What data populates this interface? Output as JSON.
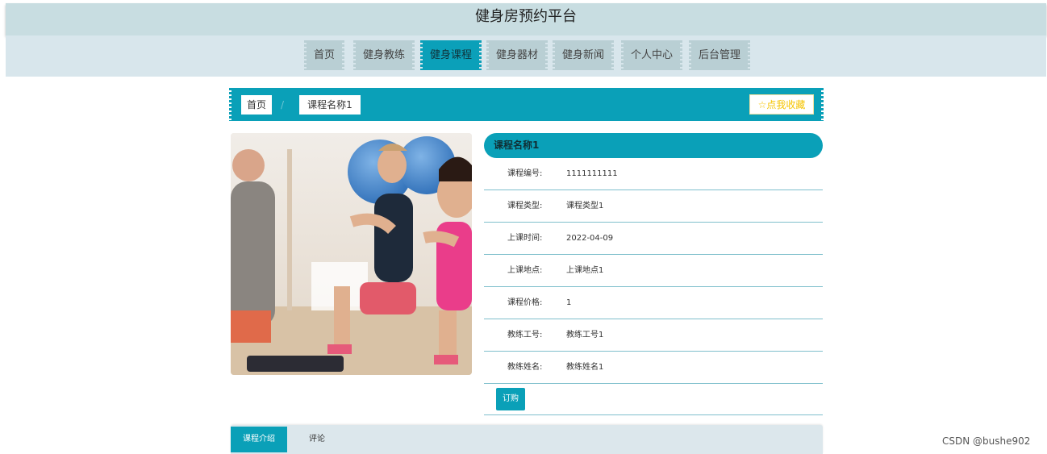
{
  "header": {
    "title": "健身房预约平台"
  },
  "nav": {
    "items": [
      {
        "label": "首页"
      },
      {
        "label": "健身教练"
      },
      {
        "label": "健身课程",
        "active": true
      },
      {
        "label": "健身器材"
      },
      {
        "label": "健身新闻"
      },
      {
        "label": "个人中心"
      },
      {
        "label": "后台管理"
      }
    ]
  },
  "breadcrumb": {
    "home": "首页",
    "separator": "/",
    "current": "课程名称1"
  },
  "favorite": {
    "label": "☆点我收藏"
  },
  "course": {
    "name": "课程名称1",
    "fields": [
      {
        "label": "课程编号:",
        "value": "1111111111"
      },
      {
        "label": "课程类型:",
        "value": "课程类型1"
      },
      {
        "label": "上课时间:",
        "value": "2022-04-09"
      },
      {
        "label": "上课地点:",
        "value": "上课地点1"
      },
      {
        "label": "课程价格:",
        "value": "1"
      },
      {
        "label": "教练工号:",
        "value": "教练工号1"
      },
      {
        "label": "教练姓名:",
        "value": "教练姓名1"
      }
    ],
    "order_label": "订购"
  },
  "tabs": {
    "intro": "课程介绍",
    "comments": "评论"
  },
  "watermark": "CSDN @bushe902",
  "colors": {
    "accent": "#0aa0b8",
    "nav_bg": "#d8e6ec",
    "header_bg": "#c8dde1"
  }
}
